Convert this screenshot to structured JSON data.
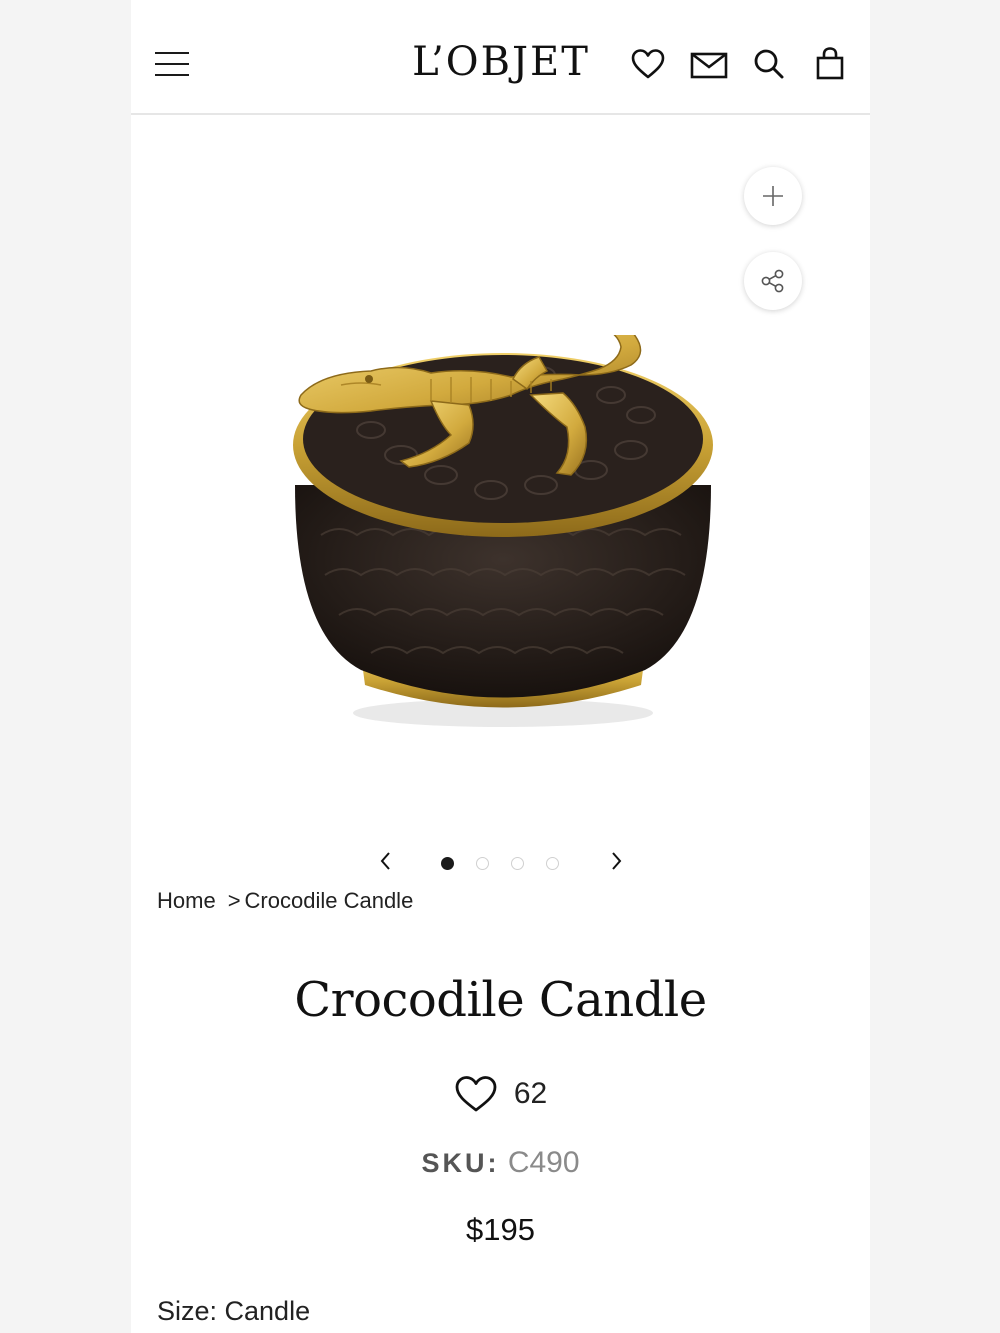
{
  "header": {
    "logo": "L’OBJET",
    "icons": [
      "menu-icon",
      "heart-icon",
      "mail-icon",
      "search-icon",
      "bag-icon"
    ]
  },
  "gallery": {
    "zoom_icon": "plus-icon",
    "share_icon": "share-icon",
    "slide_count": 4,
    "active_slide": 1
  },
  "breadcrumb": {
    "home": "Home",
    "separator": ">",
    "current": "Crocodile Candle"
  },
  "product": {
    "title": "Crocodile Candle",
    "likes": "62",
    "sku_label": "SKU:",
    "sku_value": "C490",
    "price": "$195",
    "size": "Size: Candle"
  },
  "colors": {
    "gold": "#c9a235",
    "vessel": "#2a211d",
    "dot_active": "#1a1a1a",
    "dot_inactive": "#d0d0d0"
  }
}
